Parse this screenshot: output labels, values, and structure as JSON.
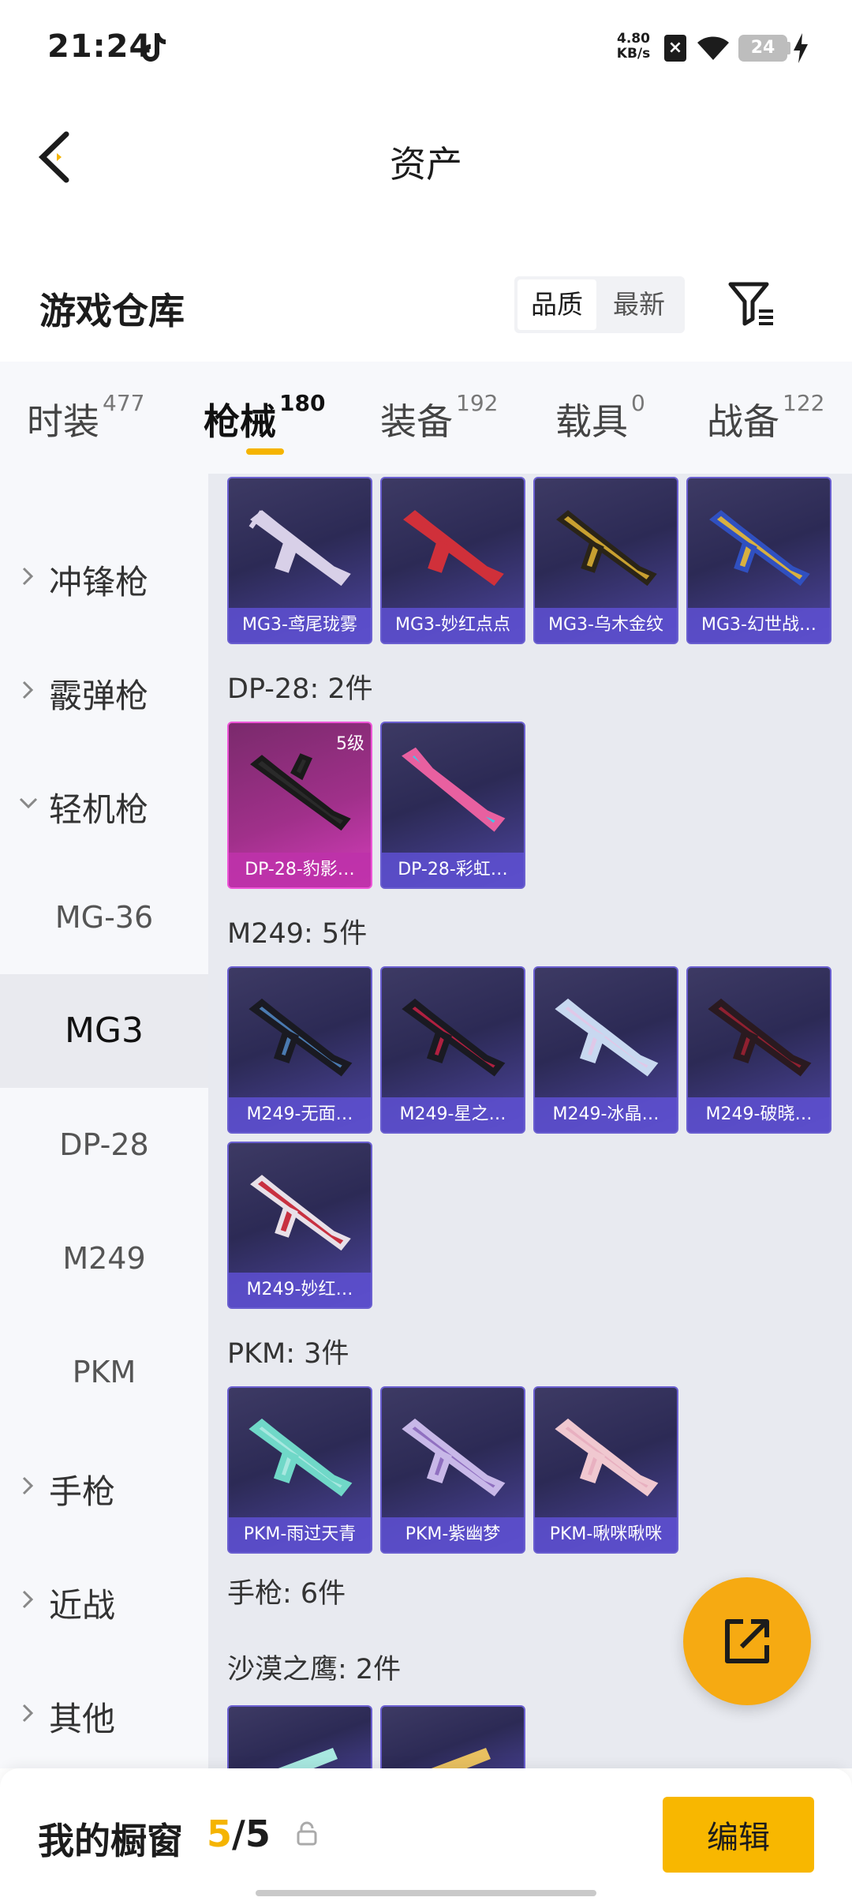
{
  "status_bar": {
    "time": "21:24",
    "net_speed_value": "4.80",
    "net_speed_unit": "KB/s",
    "battery": "24"
  },
  "header": {
    "title": "资产",
    "back_icon": "back-chevron-icon"
  },
  "section": {
    "title": "游戏仓库",
    "sort_quality": "品质",
    "sort_newest": "最新",
    "filter_icon": "filter-icon"
  },
  "tabs": [
    {
      "label": "时装",
      "count": "477"
    },
    {
      "label": "枪械",
      "count": "180"
    },
    {
      "label": "装备",
      "count": "192"
    },
    {
      "label": "载具",
      "count": "0"
    },
    {
      "label": "战备",
      "count": "122"
    }
  ],
  "sidebar": {
    "smg": "冲锋枪",
    "shotgun": "霰弹枪",
    "lmg": "轻机枪",
    "lmg_sub": [
      "MG-36",
      "MG3",
      "DP-28",
      "M249",
      "PKM"
    ],
    "pistol": "手枪",
    "melee": "近战",
    "other": "其他"
  },
  "content": {
    "mg3_cards": [
      "MG3-鸢尾珑雾",
      "MG3-妙红点点",
      "MG3-乌木金纹",
      "MG3-幻世战…"
    ],
    "dp28_title": "DP-28: 2件",
    "dp28_cards": [
      "DP-28-豹影…",
      "DP-28-彩虹…"
    ],
    "dp28_level": "5级",
    "m249_title": "M249: 5件",
    "m249_cards": [
      "M249-无面…",
      "M249-星之…",
      "M249-冰晶…",
      "M249-破晓…",
      "M249-妙红…"
    ],
    "pkm_title": "PKM: 3件",
    "pkm_cards": [
      "PKM-雨过天青",
      "PKM-紫幽梦",
      "PKM-啾咪啾咪"
    ],
    "pistol_title": "手枪: 6件",
    "deagle_title": "沙漠之鹰: 2件"
  },
  "bottom_bar": {
    "label": "我的橱窗",
    "count_current": "5",
    "count_total": "5",
    "edit": "编辑"
  },
  "colors": {
    "accent": "#f5b400",
    "card_border": "#6a5fd0",
    "card_pink": "#d43dbb"
  }
}
